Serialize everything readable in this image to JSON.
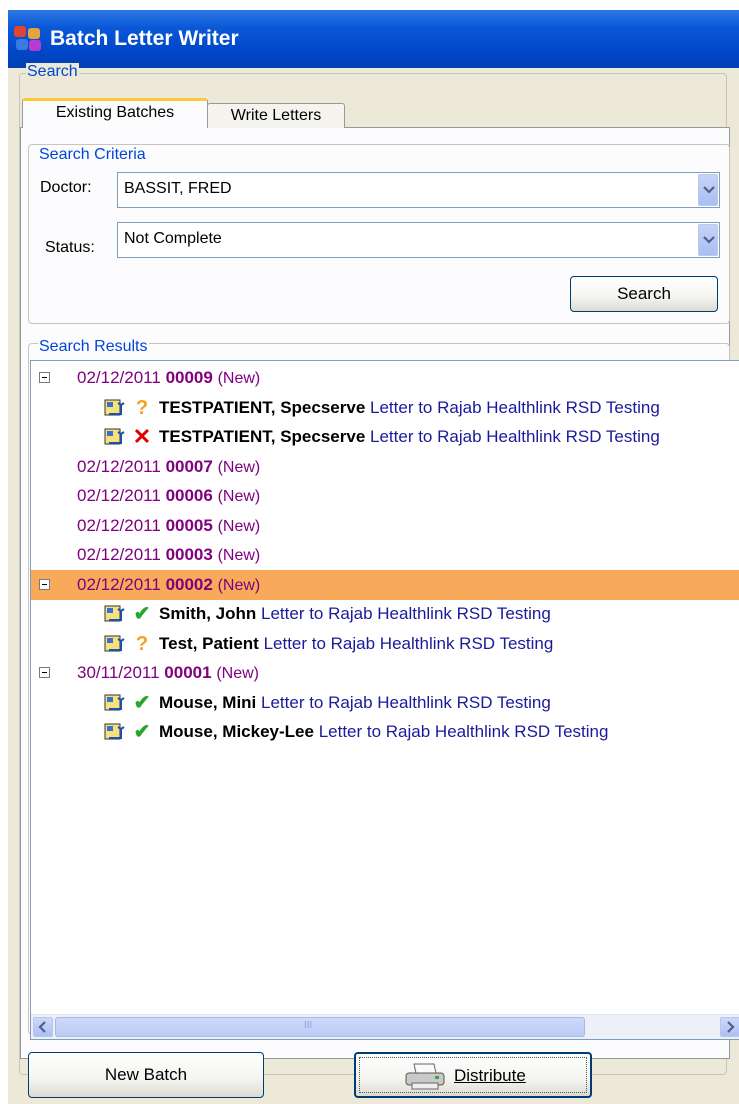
{
  "window": {
    "title": "Batch Letter Writer"
  },
  "search_group": {
    "label": "Search"
  },
  "tabs": [
    {
      "label": "Existing Batches",
      "active": true
    },
    {
      "label": "Write Letters",
      "active": false
    }
  ],
  "criteria": {
    "label": "Search Criteria",
    "doctor_label": "Doctor:",
    "doctor_value": "BASSIT,  FRED",
    "status_label": "Status:",
    "status_value": "Not Complete",
    "search_button": "Search"
  },
  "results": {
    "label": "Search Results",
    "rows": [
      {
        "kind": "batch",
        "expanded": true,
        "date": "02/12/2011",
        "number": "00009",
        "state": "(New)",
        "highlighted": false
      },
      {
        "kind": "letter",
        "status": "pending",
        "patient": "TESTPATIENT, Specserve",
        "letter": "Letter to Rajab Healthlink RSD Testing"
      },
      {
        "kind": "letter",
        "status": "failed",
        "patient": "TESTPATIENT, Specserve",
        "letter": "Letter to Rajab Healthlink RSD Testing"
      },
      {
        "kind": "batch",
        "expanded": false,
        "date": "02/12/2011",
        "number": "00007",
        "state": "(New)",
        "highlighted": false
      },
      {
        "kind": "batch",
        "expanded": false,
        "date": "02/12/2011",
        "number": "00006",
        "state": "(New)",
        "highlighted": false
      },
      {
        "kind": "batch",
        "expanded": false,
        "date": "02/12/2011",
        "number": "00005",
        "state": "(New)",
        "highlighted": false
      },
      {
        "kind": "batch",
        "expanded": false,
        "date": "02/12/2011",
        "number": "00003",
        "state": "(New)",
        "highlighted": false
      },
      {
        "kind": "batch",
        "expanded": true,
        "date": "02/12/2011",
        "number": "00002",
        "state": "(New)",
        "highlighted": true
      },
      {
        "kind": "letter",
        "status": "complete",
        "patient": "Smith, John",
        "letter": "Letter to Rajab Healthlink RSD Testing"
      },
      {
        "kind": "letter",
        "status": "pending",
        "patient": "Test, Patient",
        "letter": "Letter to Rajab Healthlink RSD Testing"
      },
      {
        "kind": "batch",
        "expanded": true,
        "date": "30/11/2011",
        "number": "00001",
        "state": "(New)",
        "highlighted": false
      },
      {
        "kind": "letter",
        "status": "complete",
        "patient": "Mouse, Mini",
        "letter": "Letter to Rajab Healthlink RSD Testing"
      },
      {
        "kind": "letter",
        "status": "complete",
        "patient": "Mouse, Mickey-Lee",
        "letter": "Letter to Rajab Healthlink RSD Testing"
      }
    ]
  },
  "scrollbar": {
    "thumb_grip": "III"
  },
  "footer": {
    "new_batch_button": "New Batch",
    "distribute_button": "Distribute"
  },
  "icons": {
    "status_pending": "question-icon",
    "status_failed": "cross-icon",
    "status_complete": "checkmark-icon",
    "status_glyphs": {
      "pending": "?",
      "failed": "✕",
      "complete": "✔"
    }
  },
  "colors": {
    "title_bar": "#0047c9",
    "group_label": "#0046d5",
    "batch_text": "#800080",
    "letter_text": "#1a1a9a",
    "highlight_row": "#f8a95a",
    "active_tab_accent": "#ffc83c"
  }
}
